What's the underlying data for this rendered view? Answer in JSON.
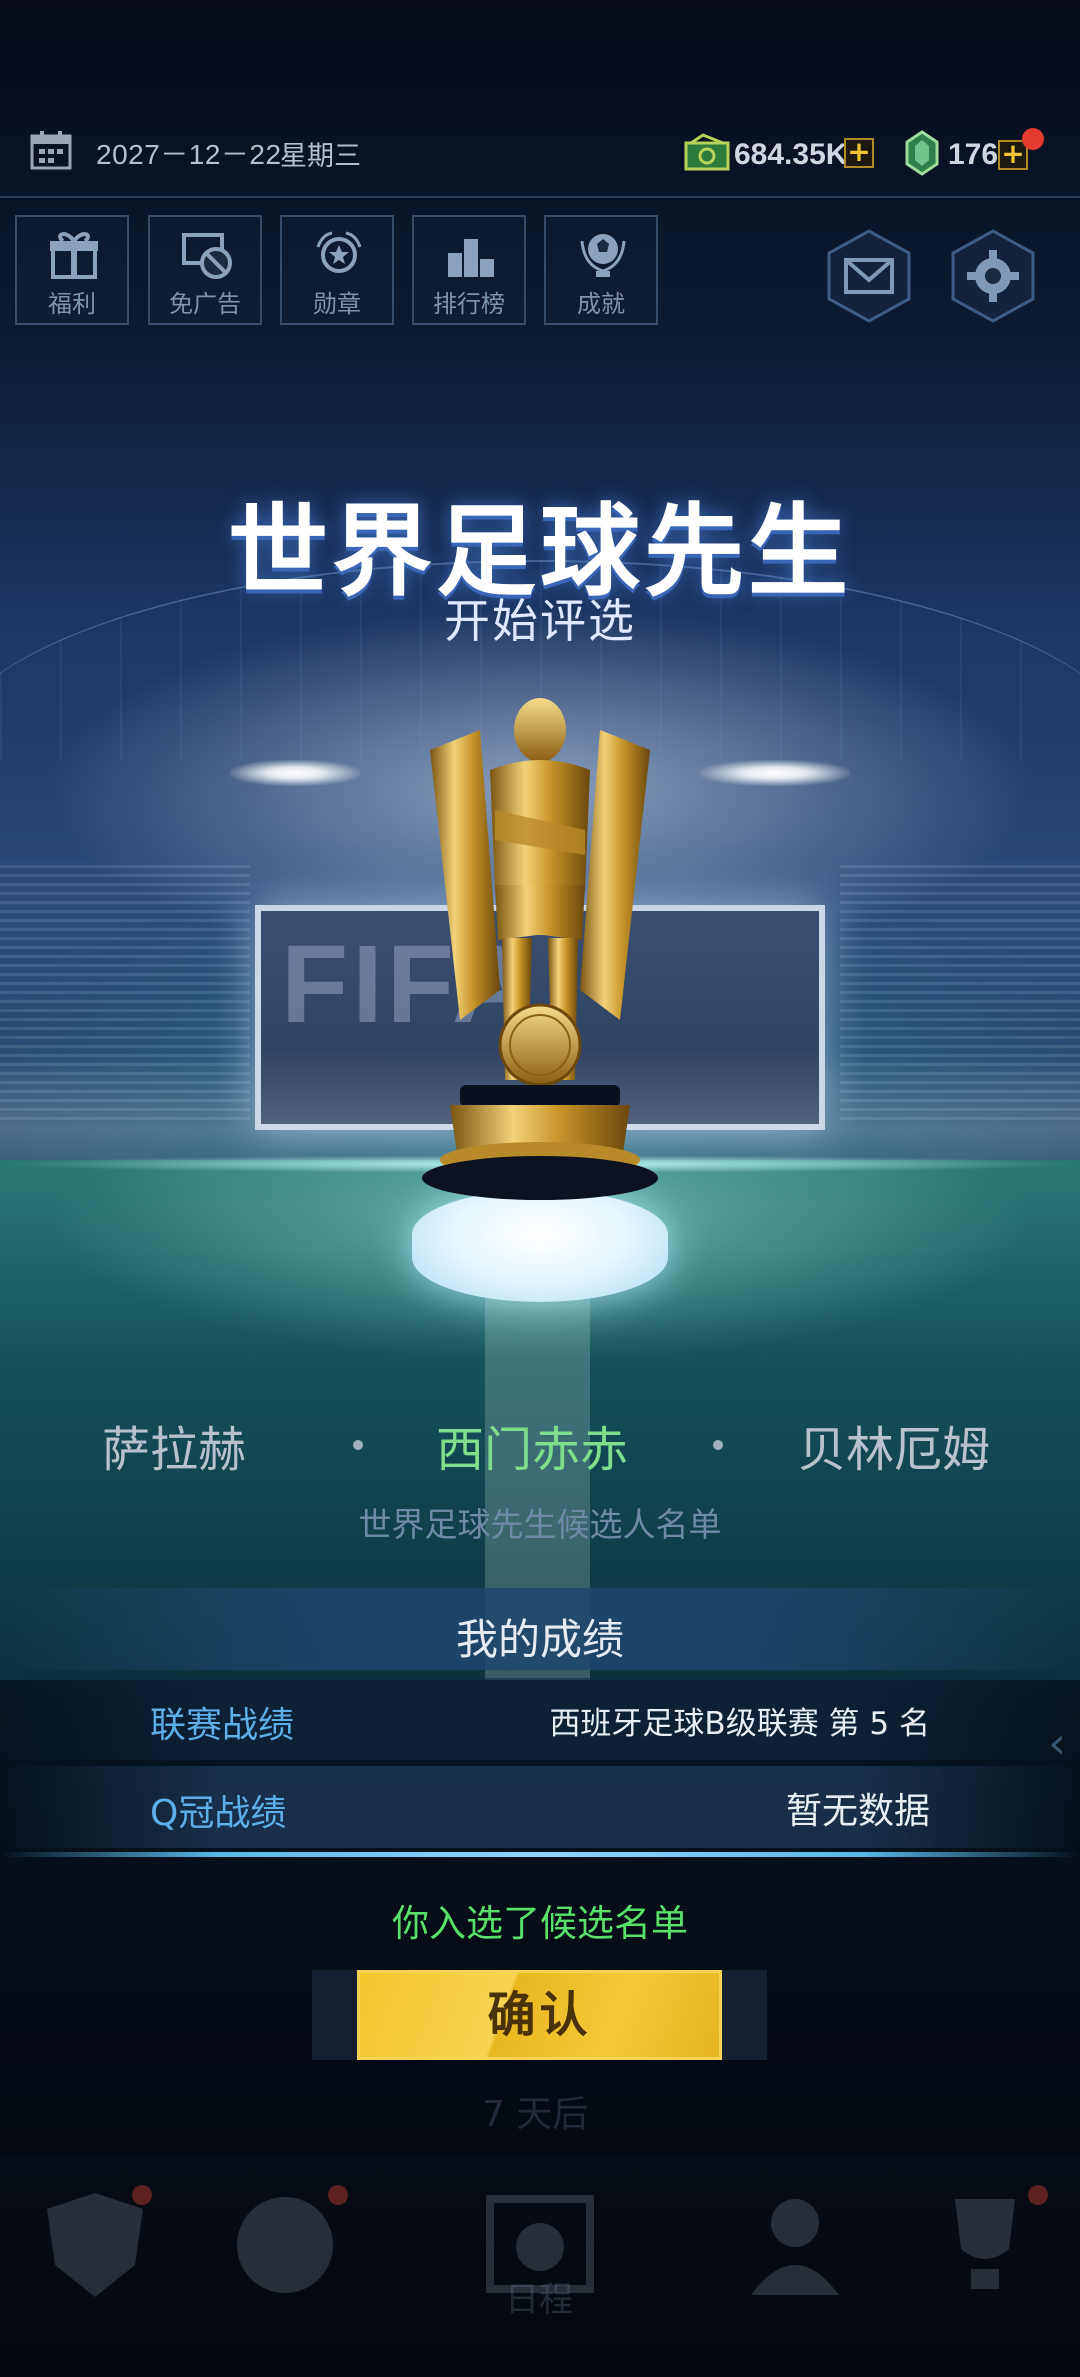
{
  "status_bar": {
    "date": "2027－12－22",
    "weekday": "星期三",
    "cash": "684.35K",
    "gems": "176"
  },
  "top_menu": [
    {
      "label": "福利",
      "icon": "gift-icon"
    },
    {
      "label": "免广告",
      "icon": "no-ads-icon"
    },
    {
      "label": "勋章",
      "icon": "medal-icon"
    },
    {
      "label": "排行榜",
      "icon": "podium-icon"
    },
    {
      "label": "成就",
      "icon": "trophy-ball-icon"
    }
  ],
  "title": "世界足球先生",
  "subtitle": "开始评选",
  "candidates": {
    "names": [
      "萨拉赫",
      "西门赤赤",
      "贝林厄姆"
    ],
    "highlight_color": "#7fdd8c",
    "caption": "世界足球先生候选人名单"
  },
  "results": {
    "heading": "我的成绩",
    "rows": [
      {
        "label": "联赛战绩",
        "value": "西班牙足球B级联赛 第 5 名"
      },
      {
        "label": "Q冠战绩",
        "value": "暂无数据"
      }
    ]
  },
  "message": "你入选了候选名单",
  "confirm_label": "确认",
  "background_text": {
    "countdown": "7 天后"
  },
  "bottom_nav": {
    "active_label": "日程"
  },
  "colors": {
    "accent_gold": "#f2c52a",
    "label_blue": "#5eaee8",
    "success_green": "#58e06a"
  }
}
